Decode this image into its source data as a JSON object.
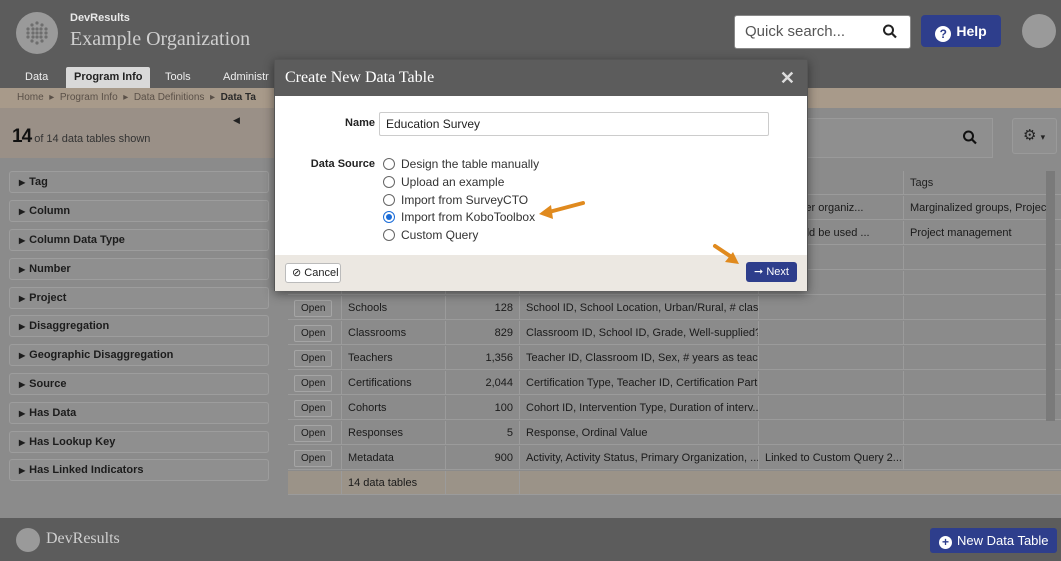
{
  "header": {
    "brand_small": "DevResults",
    "org_name": "Example Organization",
    "quick_search_placeholder": "Quick search...",
    "help_label": "Help"
  },
  "nav": {
    "tabs": [
      {
        "label": "Data",
        "active": false
      },
      {
        "label": "Program Info",
        "active": true
      },
      {
        "label": "Tools",
        "active": false
      },
      {
        "label": "Administr",
        "active": false
      }
    ]
  },
  "breadcrumb": {
    "items": [
      "Home",
      "Program Info",
      "Data Definitions"
    ],
    "current": "Data Ta",
    "separator": "▸"
  },
  "sidebar": {
    "count": "14",
    "count_suffix": "of 14 data tables shown",
    "filters": [
      "Tag",
      "Column",
      "Column Data Type",
      "Number",
      "Project",
      "Disaggregation",
      "Geographic Disaggregation",
      "Source",
      "Has Data",
      "Has Lookup Key",
      "Has Linked Indicators"
    ]
  },
  "table": {
    "tags_header": "Tags",
    "top_rows": [
      {
        "desc": "on partner organiz...",
        "tags": "Marginalized groups, Project"
      },
      {
        "desc": "ble should be used ...",
        "tags": "Project management"
      }
    ],
    "rows": [
      {
        "action": "Open",
        "name": "Schools",
        "count": "128",
        "columns": "School ID, School Location, Urban/Rural, # clas...",
        "desc": "",
        "tags": ""
      },
      {
        "action": "Open",
        "name": "Classrooms",
        "count": "829",
        "columns": "Classroom ID, School ID, Grade, Well-supplied?...",
        "desc": "",
        "tags": ""
      },
      {
        "action": "Open",
        "name": "Teachers",
        "count": "1,356",
        "columns": "Teacher ID, Classroom ID, Sex, # years as teach...",
        "desc": "",
        "tags": ""
      },
      {
        "action": "Open",
        "name": "Certifications",
        "count": "2,044",
        "columns": "Certification Type, Teacher ID, Certification Part...",
        "desc": "",
        "tags": ""
      },
      {
        "action": "Open",
        "name": "Cohorts",
        "count": "100",
        "columns": "Cohort ID, Intervention Type, Duration of interv...",
        "desc": "",
        "tags": ""
      },
      {
        "action": "Open",
        "name": "Responses",
        "count": "5",
        "columns": "Response, Ordinal Value",
        "desc": "",
        "tags": ""
      },
      {
        "action": "Open",
        "name": "Metadata",
        "count": "900",
        "columns": "Activity, Activity Status, Primary Organization, ...",
        "desc": "Linked to Custom Query 2...",
        "tags": ""
      }
    ],
    "footer_total": "14 data tables"
  },
  "footer": {
    "brand": "DevResults",
    "new_table_label": "New Data Table"
  },
  "modal": {
    "title": "Create New Data Table",
    "name_label": "Name",
    "name_value": "Education Survey",
    "source_label": "Data Source",
    "options": [
      {
        "label": "Design the table manually",
        "selected": false
      },
      {
        "label": "Upload an example",
        "selected": false
      },
      {
        "label": "Import from SurveyCTO",
        "selected": false
      },
      {
        "label": "Import from KoboToolbox",
        "selected": true
      },
      {
        "label": "Custom Query",
        "selected": false
      }
    ],
    "cancel_label": "Cancel",
    "next_label": "Next"
  },
  "colors": {
    "accent": "#2e3e8c",
    "arrow": "#e08a1e",
    "radio_selected": "#1a6cd8"
  }
}
